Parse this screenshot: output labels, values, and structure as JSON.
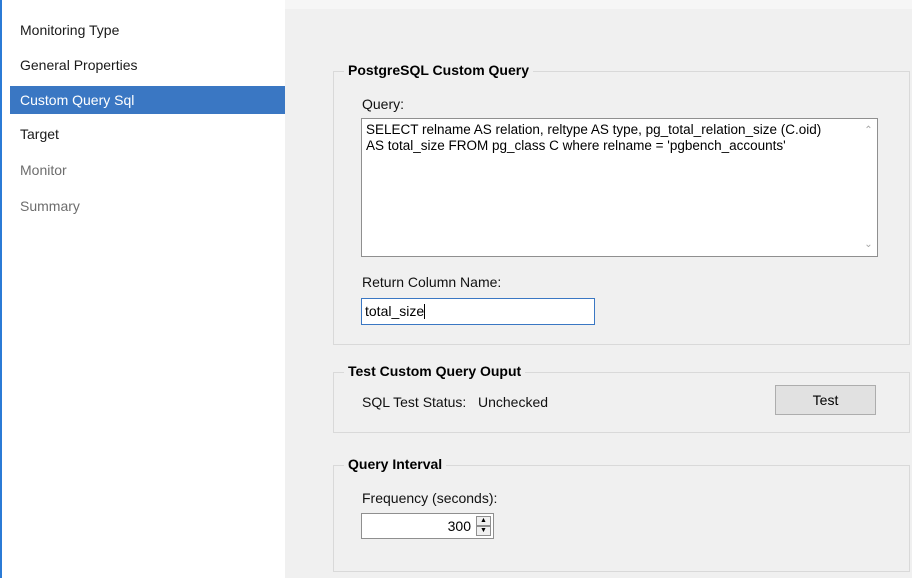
{
  "sidebar": {
    "items": [
      {
        "label": "Monitoring Type",
        "state": "normal"
      },
      {
        "label": "General Properties",
        "state": "normal"
      },
      {
        "label": "Custom Query Sql",
        "state": "selected"
      },
      {
        "label": "Target",
        "state": "normal"
      },
      {
        "label": "Monitor",
        "state": "disabled"
      },
      {
        "label": "Summary",
        "state": "disabled"
      }
    ]
  },
  "custom_query": {
    "group_title": "PostgreSQL Custom Query",
    "query_label": "Query:",
    "query_value": "SELECT relname AS relation, reltype AS type, pg_total_relation_size (C.oid) AS total_size FROM pg_class C where relname = 'pgbench_accounts'",
    "return_column_label": "Return Column Name:",
    "return_column_value": "total_size"
  },
  "test_output": {
    "group_title": "Test Custom Query Ouput",
    "status_label": "SQL Test Status:",
    "status_value": "Unchecked",
    "test_button": "Test"
  },
  "interval": {
    "group_title": "Query Interval",
    "frequency_label": "Frequency (seconds):",
    "frequency_value": "300"
  },
  "colors": {
    "selected_bg": "#3a77c3",
    "accent_edge": "#2b7bd6"
  }
}
